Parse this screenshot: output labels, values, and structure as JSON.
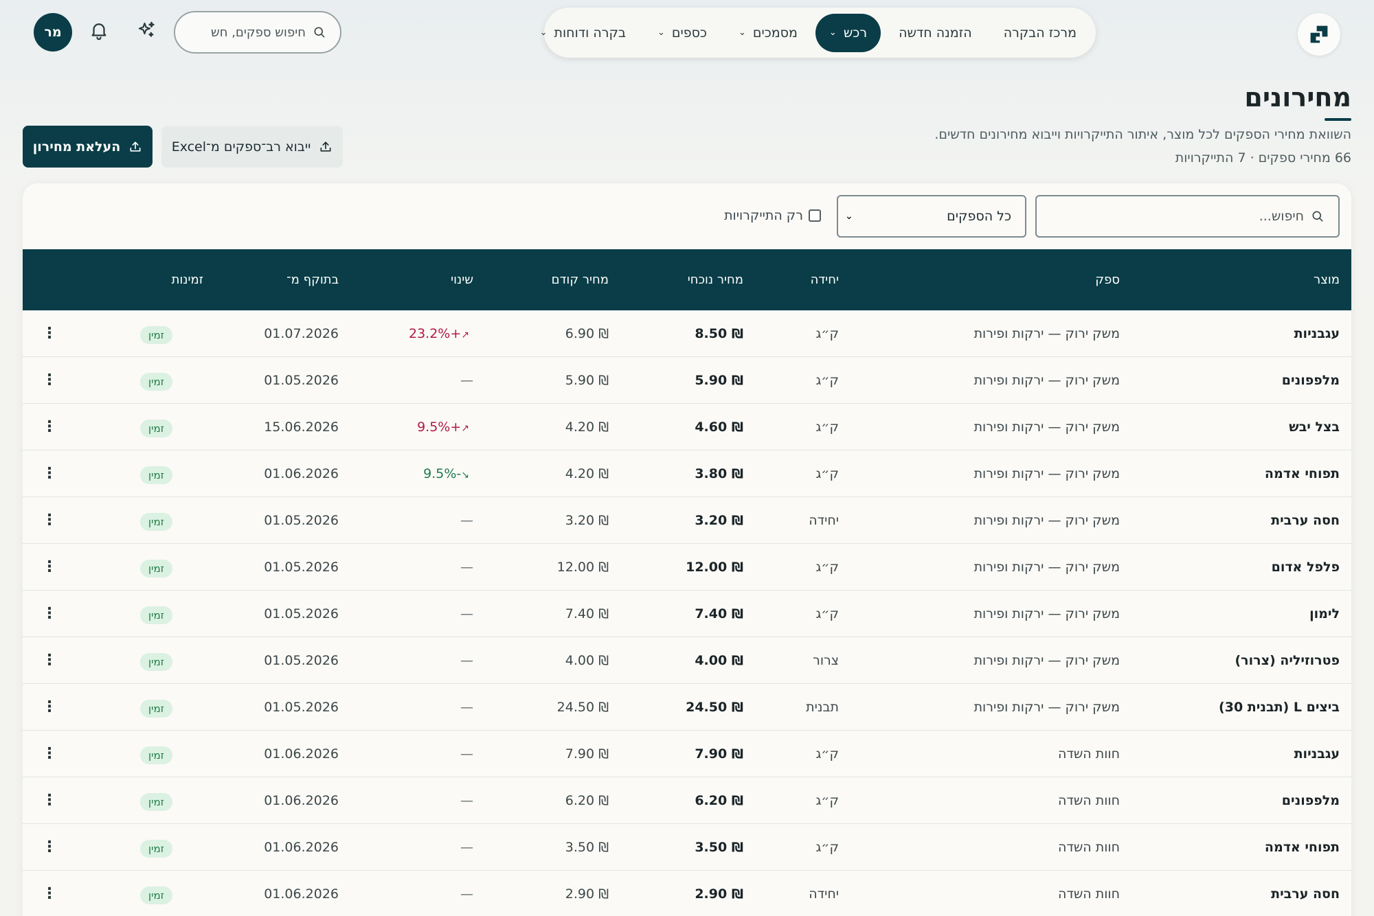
{
  "topbar": {
    "avatar_initials": "מר",
    "search_placeholder": "חיפוש ספקים, חש",
    "nav": [
      {
        "label": "מרכז הבקרה",
        "has_dropdown": false,
        "active": false
      },
      {
        "label": "הזמנה חדשה",
        "has_dropdown": false,
        "active": false
      },
      {
        "label": "רכש",
        "has_dropdown": true,
        "active": true
      },
      {
        "label": "מסמכים",
        "has_dropdown": true,
        "active": false
      },
      {
        "label": "כספים",
        "has_dropdown": true,
        "active": false
      },
      {
        "label": "בקרה ודוחות",
        "has_dropdown": true,
        "active": false
      }
    ]
  },
  "header": {
    "title": "מחירונים",
    "subtitle": "השוואת מחירי הספקים לכל מוצר, איתור התייקרויות וייבוא מחירונים חדשים.",
    "counts": "66 מחירי ספקים · 7 התייקרויות",
    "upload_button": "העלאת מחירון",
    "import_button": "ייבוא רב־ספקים מ־Excel"
  },
  "filters": {
    "search_placeholder": "חיפוש...",
    "supplier_select": "כל הספקים",
    "only_increases_label": "רק התייקרויות"
  },
  "table": {
    "columns": {
      "product": "מוצר",
      "supplier": "ספק",
      "unit": "יחידה",
      "current_price": "מחיר נוכחי",
      "previous_price": "מחיר קודם",
      "change": "שינוי",
      "valid_from": "בתוקף מ־",
      "availability": "זמינות"
    },
    "rows": [
      {
        "product": "עגבניות",
        "supplier": "משק ירוק — ירקות ופירות",
        "unit": "ק״ג",
        "current": "₪ 8.50",
        "previous": "₪ 6.90",
        "change": "+23.2%",
        "trend": "up",
        "date": "01.07.2026",
        "status": "זמין"
      },
      {
        "product": "מלפפונים",
        "supplier": "משק ירוק — ירקות ופירות",
        "unit": "ק״ג",
        "current": "₪ 5.90",
        "previous": "₪ 5.90",
        "change": "—",
        "trend": "none",
        "date": "01.05.2026",
        "status": "זמין"
      },
      {
        "product": "בצל יבש",
        "supplier": "משק ירוק — ירקות ופירות",
        "unit": "ק״ג",
        "current": "₪ 4.60",
        "previous": "₪ 4.20",
        "change": "+9.5%",
        "trend": "up",
        "date": "15.06.2026",
        "status": "זמין"
      },
      {
        "product": "תפוחי אדמה",
        "supplier": "משק ירוק — ירקות ופירות",
        "unit": "ק״ג",
        "current": "₪ 3.80",
        "previous": "₪ 4.20",
        "change": "-9.5%",
        "trend": "down",
        "date": "01.06.2026",
        "status": "זמין"
      },
      {
        "product": "חסה ערבית",
        "supplier": "משק ירוק — ירקות ופירות",
        "unit": "יחידה",
        "current": "₪ 3.20",
        "previous": "₪ 3.20",
        "change": "—",
        "trend": "none",
        "date": "01.05.2026",
        "status": "זמין"
      },
      {
        "product": "פלפל אדום",
        "supplier": "משק ירוק — ירקות ופירות",
        "unit": "ק״ג",
        "current": "₪ 12.00",
        "previous": "₪ 12.00",
        "change": "—",
        "trend": "none",
        "date": "01.05.2026",
        "status": "זמין"
      },
      {
        "product": "לימון",
        "supplier": "משק ירוק — ירקות ופירות",
        "unit": "ק״ג",
        "current": "₪ 7.40",
        "previous": "₪ 7.40",
        "change": "—",
        "trend": "none",
        "date": "01.05.2026",
        "status": "זמין"
      },
      {
        "product": "פטרוזיליה (צרור)",
        "supplier": "משק ירוק — ירקות ופירות",
        "unit": "צרור",
        "current": "₪ 4.00",
        "previous": "₪ 4.00",
        "change": "—",
        "trend": "none",
        "date": "01.05.2026",
        "status": "זמין"
      },
      {
        "product": "ביצים L (תבנית 30)",
        "supplier": "משק ירוק — ירקות ופירות",
        "unit": "תבנית",
        "current": "₪ 24.50",
        "previous": "₪ 24.50",
        "change": "—",
        "trend": "none",
        "date": "01.05.2026",
        "status": "זמין"
      },
      {
        "product": "עגבניות",
        "supplier": "חוות השדה",
        "unit": "ק״ג",
        "current": "₪ 7.90",
        "previous": "₪ 7.90",
        "change": "—",
        "trend": "none",
        "date": "01.06.2026",
        "status": "זמין"
      },
      {
        "product": "מלפפונים",
        "supplier": "חוות השדה",
        "unit": "ק״ג",
        "current": "₪ 6.20",
        "previous": "₪ 6.20",
        "change": "—",
        "trend": "none",
        "date": "01.06.2026",
        "status": "זמין"
      },
      {
        "product": "תפוחי אדמה",
        "supplier": "חוות השדה",
        "unit": "ק״ג",
        "current": "₪ 3.50",
        "previous": "₪ 3.50",
        "change": "—",
        "trend": "none",
        "date": "01.06.2026",
        "status": "זמין"
      },
      {
        "product": "חסה ערבית",
        "supplier": "חוות השדה",
        "unit": "יחידה",
        "current": "₪ 2.90",
        "previous": "₪ 2.90",
        "change": "—",
        "trend": "none",
        "date": "01.06.2026",
        "status": "זמין"
      }
    ]
  },
  "colors": {
    "primary": "#0a3d47",
    "increase": "#b0194a",
    "decrease": "#1d7a4c",
    "available_badge_bg": "#dbf1e2",
    "available_badge_text": "#1f7a46"
  }
}
